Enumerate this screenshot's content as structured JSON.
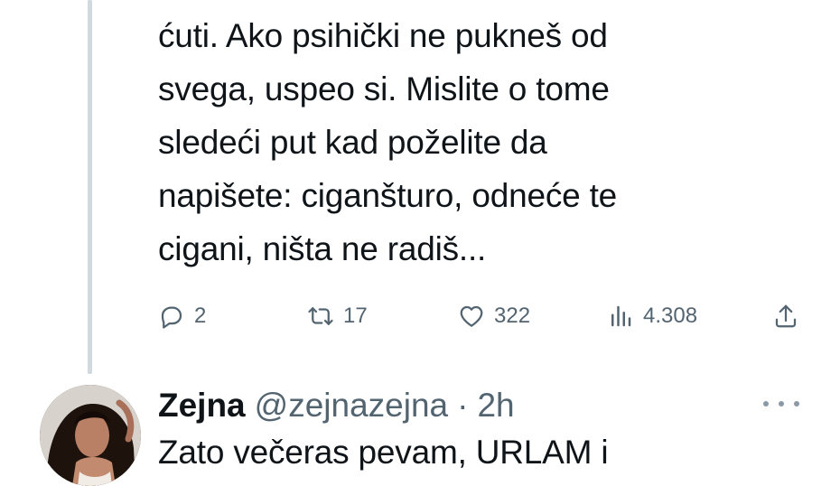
{
  "tweet": {
    "text": "ćuti. Ako psihički ne pukneš od\nsvega, uspeo si. Mislite o tome\nsledeći put kad poželite da\nnapišete: ciganšturo, odneće te\ncigani, ništa ne radiš...",
    "actions": {
      "replies": "2",
      "retweets": "17",
      "likes": "322",
      "views": "4.308"
    }
  },
  "reply": {
    "name": "Zejna",
    "handle": "@zejnazejna",
    "separator": "·",
    "time": "2h",
    "text": "Zato večeras pevam, URLAM i"
  },
  "icons": {
    "reply": "reply-icon",
    "retweet": "retweet-icon",
    "like": "heart-icon",
    "views": "views-icon",
    "share": "share-icon",
    "more": "more-icon"
  },
  "colors": {
    "text": "#0f1419",
    "secondary": "#536471",
    "thread_line": "#cfd9de"
  }
}
